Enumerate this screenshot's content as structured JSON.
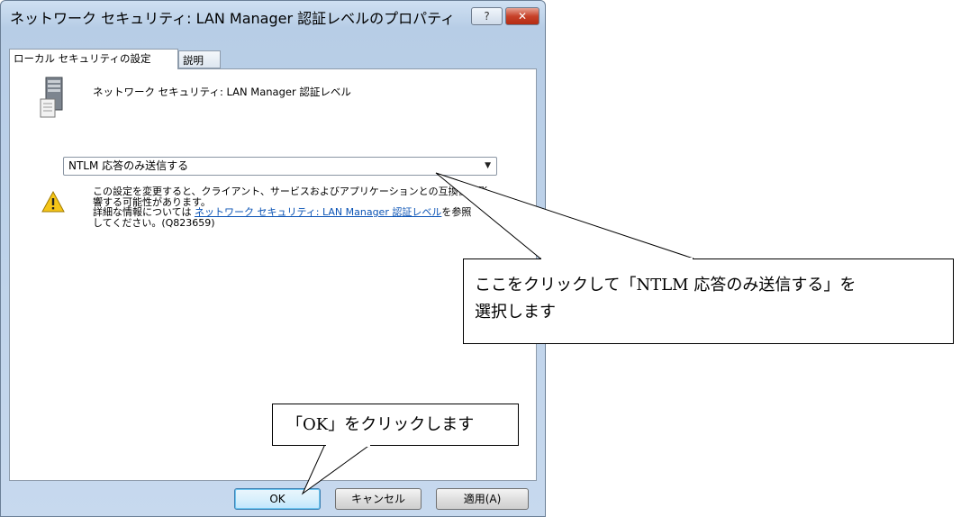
{
  "window": {
    "title": "ネットワーク セキュリティ: LAN Manager 認証レベルのプロパティ",
    "help_label": "?",
    "close_label": "✕"
  },
  "tabs": [
    {
      "label": "ローカル セキュリティの設定"
    },
    {
      "label": "説明"
    }
  ],
  "policy": {
    "name": "ネットワーク セキュリティ: LAN Manager 認証レベル",
    "icon": "server-icon"
  },
  "dropdown": {
    "selected": "NTLM 応答のみ送信する"
  },
  "warning": {
    "icon": "warning-icon",
    "line1": "この設定を変更すると、クライアント、サービスおよびアプリケーションとの互換性に影",
    "line2": "響する可能性があります。",
    "line3_prefix": "詳細な情報については ",
    "link": "ネットワーク セキュリティ: LAN Manager 認証レベル",
    "line3_suffix": "を参照",
    "line4": "してください。(Q823659)"
  },
  "buttons": {
    "ok": "OK",
    "cancel": "キャンセル",
    "apply": "適用(A)"
  },
  "callouts": {
    "dropdown_tip_line1": "ここをクリックして「NTLM 応答のみ送信する」を",
    "dropdown_tip_line2": "選択します",
    "ok_tip": "「OK」をクリックします"
  }
}
